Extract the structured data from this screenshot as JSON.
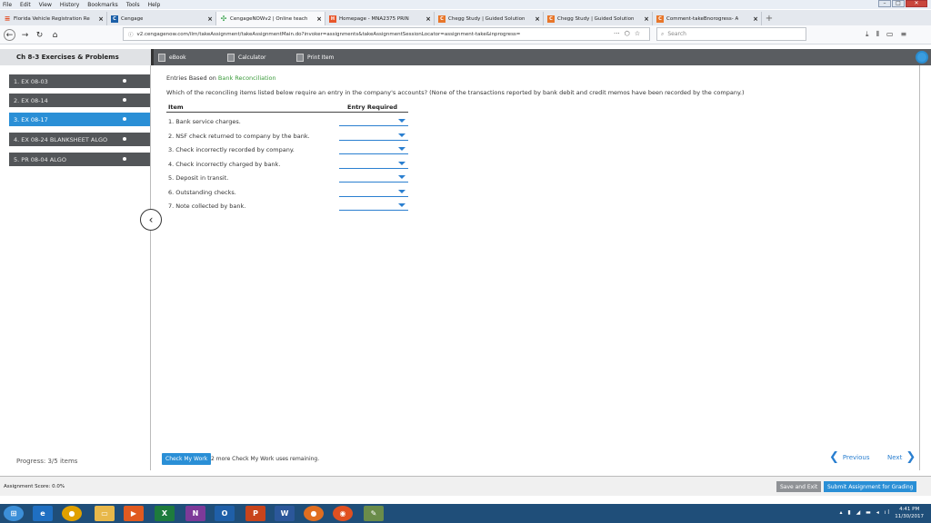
{
  "menu": [
    "File",
    "Edit",
    "View",
    "History",
    "Bookmarks",
    "Tools",
    "Help"
  ],
  "tabs": [
    {
      "label": "Florida Vehicle Registration Re",
      "color": "#e34f26",
      "glyph": "≡"
    },
    {
      "label": "Cengage",
      "color": "#1b5fa8",
      "glyph": "C"
    },
    {
      "label": "CengageNOWv2 | Online teach",
      "color": "#2f9e44",
      "glyph": "✣"
    },
    {
      "label": "Homepage - MNA2375 PRIN",
      "color": "#e8562a",
      "glyph": "H"
    },
    {
      "label": "Chegg Study | Guided Solution",
      "color": "#e8762a",
      "glyph": "C"
    },
    {
      "label": "Chegg Study | Guided Solution",
      "color": "#e8762a",
      "glyph": "C"
    },
    {
      "label": "Comment-takeBnorogress- A",
      "color": "#e8762a",
      "glyph": "C"
    }
  ],
  "nav": {
    "url": "v2.cengagenow.com/ilrn/takeAssignment/takeAssignmentMain.do?invoker=assignments&takeAssignmentSessionLocator=assignment-take&inprogress=",
    "search_placeholder": "Search",
    "more": "···"
  },
  "header": {
    "chapter_title": "Ch 8-3 Exercises & Problems",
    "ebook": "eBook",
    "calculator": "Calculator",
    "print": "Print Item"
  },
  "sidebar": {
    "items": [
      {
        "label": "1. EX 08-03",
        "active": false
      },
      {
        "label": "2. EX 08-14",
        "active": false
      },
      {
        "label": "3. EX 08-17",
        "active": true
      },
      {
        "label": "4. EX 08-24 BLANKSHEET ALGO",
        "active": false
      },
      {
        "label": "5. PR 08-04 ALGO",
        "active": false
      }
    ],
    "progress": "Progress: 3/5 items"
  },
  "main": {
    "title_prefix": "Entries Based on ",
    "title_link": "Bank Reconciliation",
    "question": "Which of the reconciling items listed below require an entry in the company's accounts? (None of the transactions reported by bank debit and credit memos have been recorded by the company.)",
    "col_item": "Item",
    "col_entry": "Entry Required",
    "rows": [
      "1. Bank service charges.",
      "2. NSF check returned to company by the bank.",
      "3. Check incorrectly recorded by company.",
      "4. Check incorrectly charged by bank.",
      "5. Deposit in transit.",
      "6. Outstanding checks.",
      "7. Note collected by bank."
    ],
    "check_btn": "Check My Work",
    "check_note": "2 more Check My Work uses remaining.",
    "previous": "Previous",
    "next": "Next"
  },
  "footer": {
    "score": "Assignment Score: 0.0%",
    "save": "Save and Exit",
    "submit": "Submit Assignment for Grading"
  },
  "taskbar": {
    "time": "4:41 PM",
    "date": "11/30/2017"
  }
}
